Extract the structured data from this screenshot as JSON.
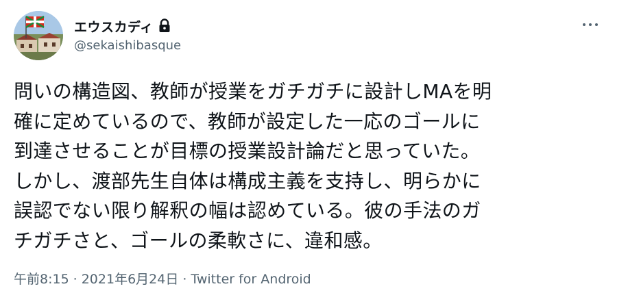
{
  "user": {
    "display_name": "エウスカディ",
    "handle": "@sekaishibasque",
    "protected_icon": "lock-icon",
    "avatar_icon": "avatar-photo"
  },
  "menu": {
    "more_icon": "more-horizontal-icon"
  },
  "tweet": {
    "lines": [
      "問いの構造図、教師が授業をガチガチに設計しMAを明",
      "確に定めているので、教師が設定した一応のゴールに",
      "到達させることが目標の授業設計論だと思っていた。",
      "しかし、渡部先生自体は構成主義を支持し、明らかに",
      "誤認でない限り解釈の幅は認めている。彼の手法のガ",
      "チガチさと、ゴールの柔軟さに、違和感。"
    ]
  },
  "meta": {
    "time": "午前8:15",
    "separator": "·",
    "date": "2021年6月24日",
    "source": "Twitter for Android"
  },
  "colors": {
    "text": "#0f1419",
    "secondary": "#536471"
  }
}
